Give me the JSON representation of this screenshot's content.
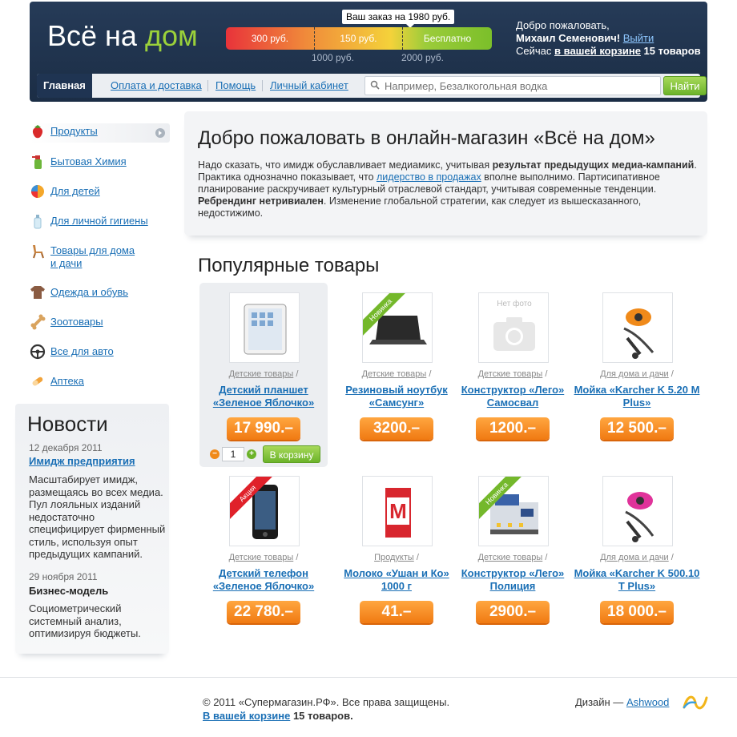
{
  "header": {
    "logo_main": "Всё на",
    "logo_accent": "дом",
    "discount": {
      "tooltip": "Ваш заказ на 1980 руб.",
      "segments": [
        "300 руб.",
        "150 руб.",
        "Бесплатно"
      ],
      "ticks": [
        "1000 руб.",
        "2000 руб."
      ]
    },
    "welcome_line": "Добро пожаловать,",
    "user_name": "Михаил Семенович",
    "logout": "Выйти",
    "now_in": "Сейчас",
    "cart_link": "в вашей корзине",
    "cart_count": "15 товаров",
    "exclamation": "!"
  },
  "nav": {
    "items": [
      "Главная",
      "Оплата и доставка",
      "Помощь",
      "Личный кабинет"
    ],
    "search_placeholder": "Например, Безалкогольная водка",
    "search_button": "Найти"
  },
  "sidebar": {
    "categories": [
      {
        "label": "Продукты",
        "icon": "strawberry-icon"
      },
      {
        "label": "Бытовая Химия",
        "icon": "spray-bottle-icon"
      },
      {
        "label": "Для детей",
        "icon": "ball-icon"
      },
      {
        "label": "Для личной гигиены",
        "icon": "lotion-bottle-icon"
      },
      {
        "label": "Товары для дома\nи дачи",
        "icon": "chair-icon"
      },
      {
        "label": "Одежда и обувь",
        "icon": "jacket-icon"
      },
      {
        "label": "Зоотовары",
        "icon": "bone-icon"
      },
      {
        "label": "Все для авто",
        "icon": "steering-wheel-icon"
      },
      {
        "label": "Аптека",
        "icon": "pill-icon"
      }
    ]
  },
  "news": {
    "title": "Новости",
    "items": [
      {
        "date": "12 декабря 2011",
        "title": "Имидж предприятия",
        "text": "Масштабирует имидж, размещаясь во всех медиа. Пул лояльных изданий недостаточно специфицирует фирменный стиль, используя опыт предыдущих кампаний."
      },
      {
        "date": "29 ноября 2011",
        "title": "Бизнес-модель",
        "text": "Социометрический системный анализ, оптимизируя бюджеты."
      }
    ]
  },
  "welcome_box": {
    "title": "Добро пожаловать в онлайн-магазин «Всё на дом»",
    "text_1": "Надо сказать, что имидж обуславливает медиамикс, учитывая ",
    "bold_1": "результат предыдущих медиа-кампаний",
    "text_2": ". Практика однозначно показывает, что ",
    "link_1": "лидерство в продажах",
    "text_3": " вполне выполнимо. Партисипативное планирование раскручивает культурный отраслевой стандарт, учитывая современные тенденции. ",
    "bold_2": "Ребрендинг нетривиален",
    "text_4": ". Изменение глобальной стратегии, как следует из вышесказанного, недостижимо."
  },
  "popular": {
    "title": "Популярные товары",
    "products": [
      {
        "category": "Детские товары",
        "name": "Детский планшет «Зеленое Яблочко»",
        "price": "17 990.–",
        "badge": "",
        "image": "tablet-image"
      },
      {
        "category": "Детские товары",
        "name": "Резиновый ноутбук «Самсунг»",
        "price": "3200.–",
        "badge": "Новинка",
        "image": "laptop-image"
      },
      {
        "category": "Детские товары",
        "name": "Конструктор «Лего» Самосвал",
        "price": "1200.–",
        "badge": "",
        "image": "no-photo-image",
        "no_photo": "Нет фото"
      },
      {
        "category": "Для дома и дачи",
        "name": "Мойка «Karcher K 5.20 M Plus»",
        "price": "12 500.–",
        "badge": "",
        "image": "pressure-washer-orange-image"
      },
      {
        "category": "Детские товары",
        "name": "Детский телефон «Зеленое Яблочко»",
        "price": "22 780.–",
        "badge": "Акция",
        "image": "phone-image"
      },
      {
        "category": "Продукты",
        "name": "Молоко «Ушан и Ко» 1000 г",
        "price": "41.–",
        "badge": "",
        "image": "milk-box-image"
      },
      {
        "category": "Детские товары",
        "name": "Конструктор «Лего» Полиция",
        "price": "2900.–",
        "badge": "Новинка",
        "image": "lego-police-image"
      },
      {
        "category": "Для дома и дачи",
        "name": "Мойка «Karcher K 500.10 T Plus»",
        "price": "18 000.–",
        "badge": "",
        "image": "pressure-washer-pink-image"
      }
    ],
    "qty_value": "1",
    "cart_button": "В корзину"
  },
  "footer": {
    "copyright": "© 2011 «Супермагазин.РФ». Все права защищены.",
    "cart_link": "В вашей корзине",
    "cart_count": "15 товаров.",
    "design_label": "Дизайн —",
    "design_link": "Ashwood"
  },
  "colors": {
    "header_bg": "#1f3452",
    "accent_green": "#9bd13a",
    "price_orange": "#f07a12",
    "link_blue": "#1a6fb5"
  }
}
